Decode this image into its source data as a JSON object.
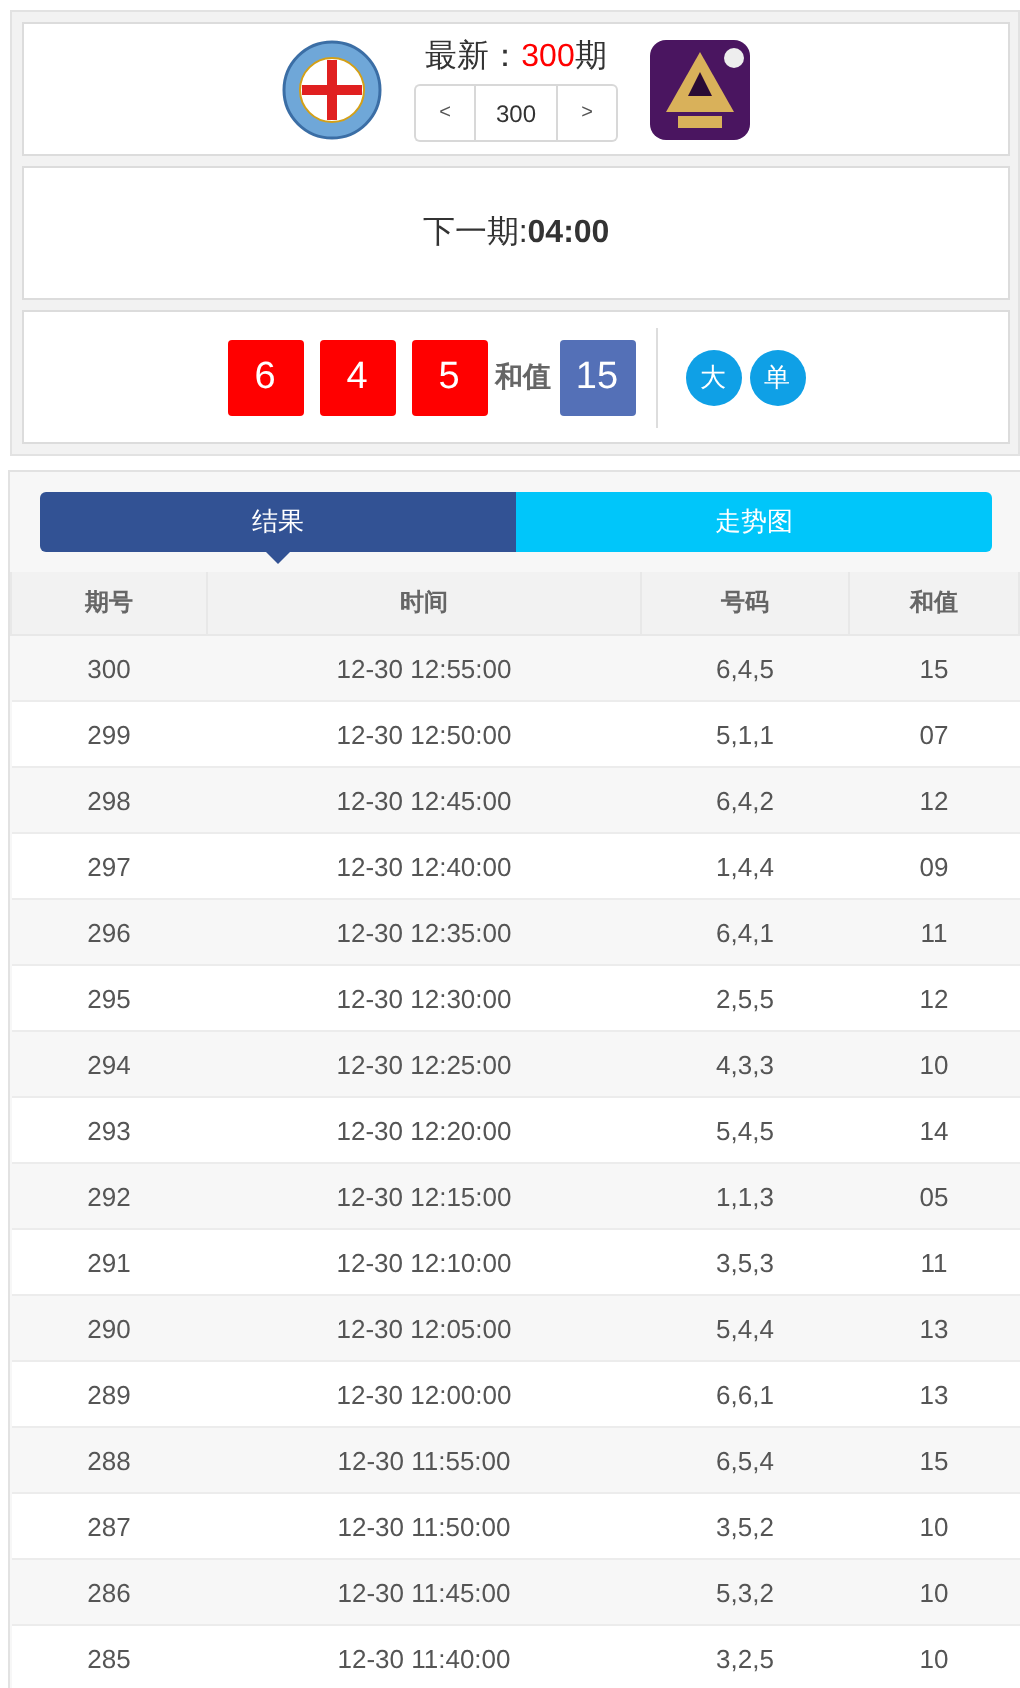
{
  "header": {
    "latest_label": "最新：",
    "latest_issue": "300",
    "issue_unit": "期",
    "prev": "<",
    "issue_field": "300",
    "next": ">"
  },
  "countdown": {
    "label": "下一期:",
    "time": "04:00"
  },
  "result": {
    "numbers": [
      "6",
      "4",
      "5"
    ],
    "sum_label": "和值",
    "sum": "15",
    "tags": [
      "大",
      "单"
    ]
  },
  "tabs": [
    {
      "label": "结果",
      "selected": true
    },
    {
      "label": "走势图",
      "selected": false
    }
  ],
  "table": {
    "columns": [
      "期号",
      "时间",
      "号码",
      "和值"
    ],
    "rows": [
      [
        "300",
        "12-30 12:55:00",
        "6,4,5",
        "15"
      ],
      [
        "299",
        "12-30 12:50:00",
        "5,1,1",
        "07"
      ],
      [
        "298",
        "12-30 12:45:00",
        "6,4,2",
        "12"
      ],
      [
        "297",
        "12-30 12:40:00",
        "1,4,4",
        "09"
      ],
      [
        "296",
        "12-30 12:35:00",
        "6,4,1",
        "11"
      ],
      [
        "295",
        "12-30 12:30:00",
        "2,5,5",
        "12"
      ],
      [
        "294",
        "12-30 12:25:00",
        "4,3,3",
        "10"
      ],
      [
        "293",
        "12-30 12:20:00",
        "5,4,5",
        "14"
      ],
      [
        "292",
        "12-30 12:15:00",
        "1,1,3",
        "05"
      ],
      [
        "291",
        "12-30 12:10:00",
        "3,5,3",
        "11"
      ],
      [
        "290",
        "12-30 12:05:00",
        "5,4,4",
        "13"
      ],
      [
        "289",
        "12-30 12:00:00",
        "6,6,1",
        "13"
      ],
      [
        "288",
        "12-30 11:55:00",
        "6,5,4",
        "15"
      ],
      [
        "287",
        "12-30 11:50:00",
        "3,5,2",
        "10"
      ],
      [
        "286",
        "12-30 11:45:00",
        "5,3,2",
        "10"
      ],
      [
        "285",
        "12-30 11:40:00",
        "3,2,5",
        "10"
      ]
    ]
  }
}
